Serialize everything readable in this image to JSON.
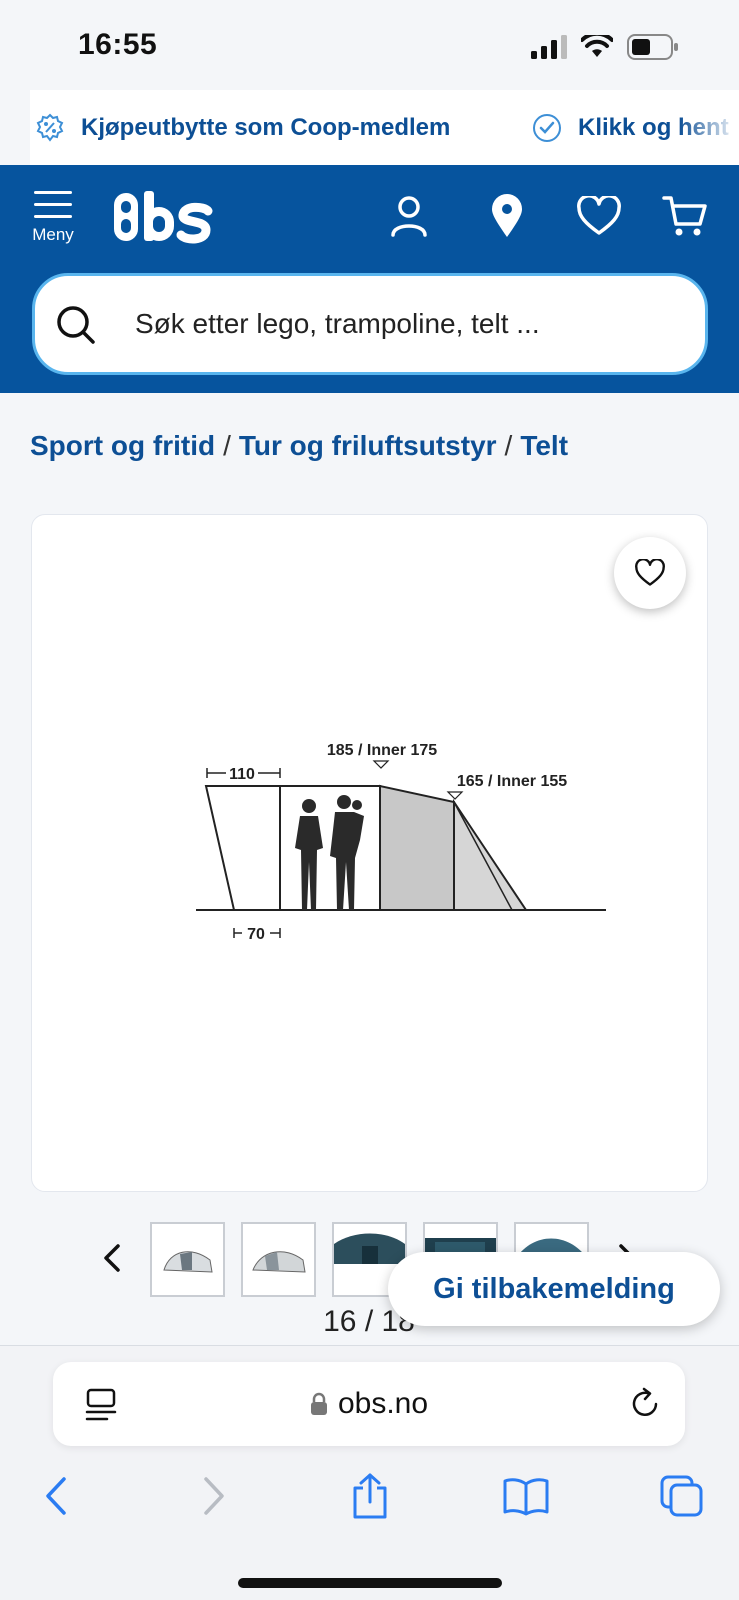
{
  "status_bar": {
    "time": "16:55"
  },
  "promo": {
    "item1": "Kjøpeutbytte som Coop-medlem",
    "item2": "Klikk og hent"
  },
  "header": {
    "menu_label": "Meny",
    "logo_text": "Obs",
    "icons": [
      "account-icon",
      "location-icon",
      "heart-icon",
      "cart-icon"
    ],
    "brand_color": "#06549e"
  },
  "search": {
    "placeholder": "Søk etter lego, trampoline, telt ..."
  },
  "breadcrumb": {
    "items": [
      "Sport og fritid",
      "Tur og friluftsutstyr",
      "Telt"
    ],
    "separator": "/"
  },
  "product_image": {
    "labels": {
      "height_front": "185 / Inner 175",
      "height_rear": "165 / Inner 155",
      "porch_top": "110",
      "porch_bottom": "70"
    }
  },
  "gallery": {
    "counter": "16 / 18",
    "thumbnail_count_visible": 5
  },
  "feedback_button": "Gi tilbakemelding",
  "browser": {
    "url": "obs.no"
  }
}
